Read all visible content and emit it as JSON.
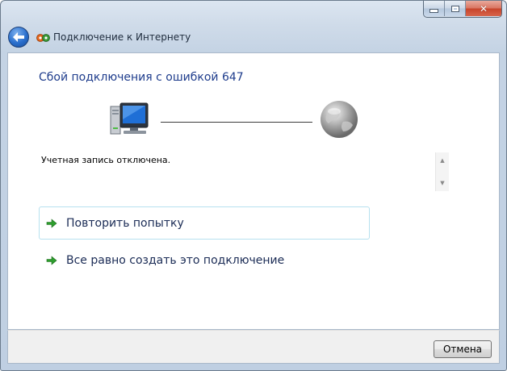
{
  "window": {
    "title": "Подключение к Интернету",
    "caption_buttons": {
      "minimize_icon": "minimize-icon",
      "maximize_icon": "maximize-icon",
      "close_label": "✕"
    }
  },
  "navigation": {
    "back_icon": "back-arrow-icon",
    "title_icon": "network-connection-icon"
  },
  "main": {
    "heading": "Сбой подключения с ошибкой 647",
    "error_message": "Учетная запись отключена.",
    "options": [
      {
        "label": "Повторить попытку",
        "icon": "green-arrow-icon"
      },
      {
        "label": "Все равно создать это подключение",
        "icon": "green-arrow-icon"
      }
    ]
  },
  "footer": {
    "cancel_label": "Отмена"
  },
  "colors": {
    "heading": "#1e3c8c",
    "option_text": "#1a2b55",
    "option_hover_border": "#b7e1ef",
    "arrow_green": "#2e9e2e"
  }
}
